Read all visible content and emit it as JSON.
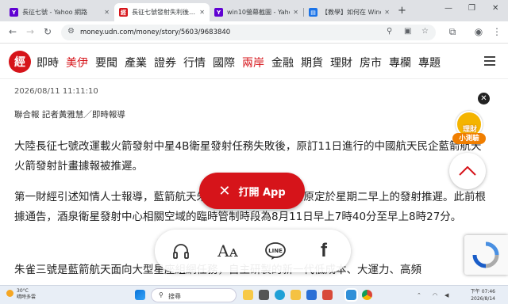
{
  "browser": {
    "tabs": [
      {
        "title": "長征七號 - Yahoo 網路",
        "favicon": "yahoo",
        "color": "#6001d2"
      },
      {
        "title": "長征七號發射失利後…",
        "favicon": "udn",
        "color": "#d6141a"
      },
      {
        "title": "win10螢幕截圖 - Yahoo",
        "favicon": "yahoo",
        "color": "#6001d2"
      },
      {
        "title": "【教學】如何在 Windo",
        "favicon": "doc",
        "color": "#1a73e8"
      }
    ],
    "active_tab": 1,
    "url": "money.udn.com/money/story/5603/9683840"
  },
  "site": {
    "logo_text": "經",
    "nav": [
      {
        "label": "即時",
        "highlight": false
      },
      {
        "label": "美伊",
        "highlight": true
      },
      {
        "label": "要聞",
        "highlight": false
      },
      {
        "label": "產業",
        "highlight": false
      },
      {
        "label": "證券",
        "highlight": false
      },
      {
        "label": "行情",
        "highlight": false
      },
      {
        "label": "國際",
        "highlight": false
      },
      {
        "label": "兩岸",
        "highlight": true
      },
      {
        "label": "金融",
        "highlight": false
      },
      {
        "label": "期貨",
        "highlight": false
      },
      {
        "label": "理財",
        "highlight": false
      },
      {
        "label": "房市",
        "highlight": false
      },
      {
        "label": "專欄",
        "highlight": false
      },
      {
        "label": "專題",
        "highlight": false
      }
    ]
  },
  "article": {
    "datetime": "2026/08/11 11:11:10",
    "byline": "聯合報 記者黃雅慧／即時報導",
    "paragraphs": [
      "大陸長征七號改運載火箭發射中星4B衛星發射任務失敗後，原訂11日進行的中國航天民企藍箭航天火箭發射計畫據報被推遲。",
      "第一財經引述知情人士報導，藍箭航天朱雀三號遙三運載火箭原定於星期二早上的發射推遲。此前根據通告，酒泉衛星發射中心相關空域的臨時管制時段為8月11日早上7時40分至早上8時27分。",
      "朱雀三號是藍箭航天面向大型星座組網任務，自主研製的新一代低成本、大運力、高頻"
    ]
  },
  "overlays": {
    "open_app_label": "打開 App",
    "badge_top": "理財",
    "badge_bottom": "小測驗"
  },
  "taskbar": {
    "weather_temp": "30°C",
    "weather_desc": "晴時多雲",
    "search_label": "搜尋",
    "time": "下午 07:46",
    "date": "2026/8/14"
  }
}
